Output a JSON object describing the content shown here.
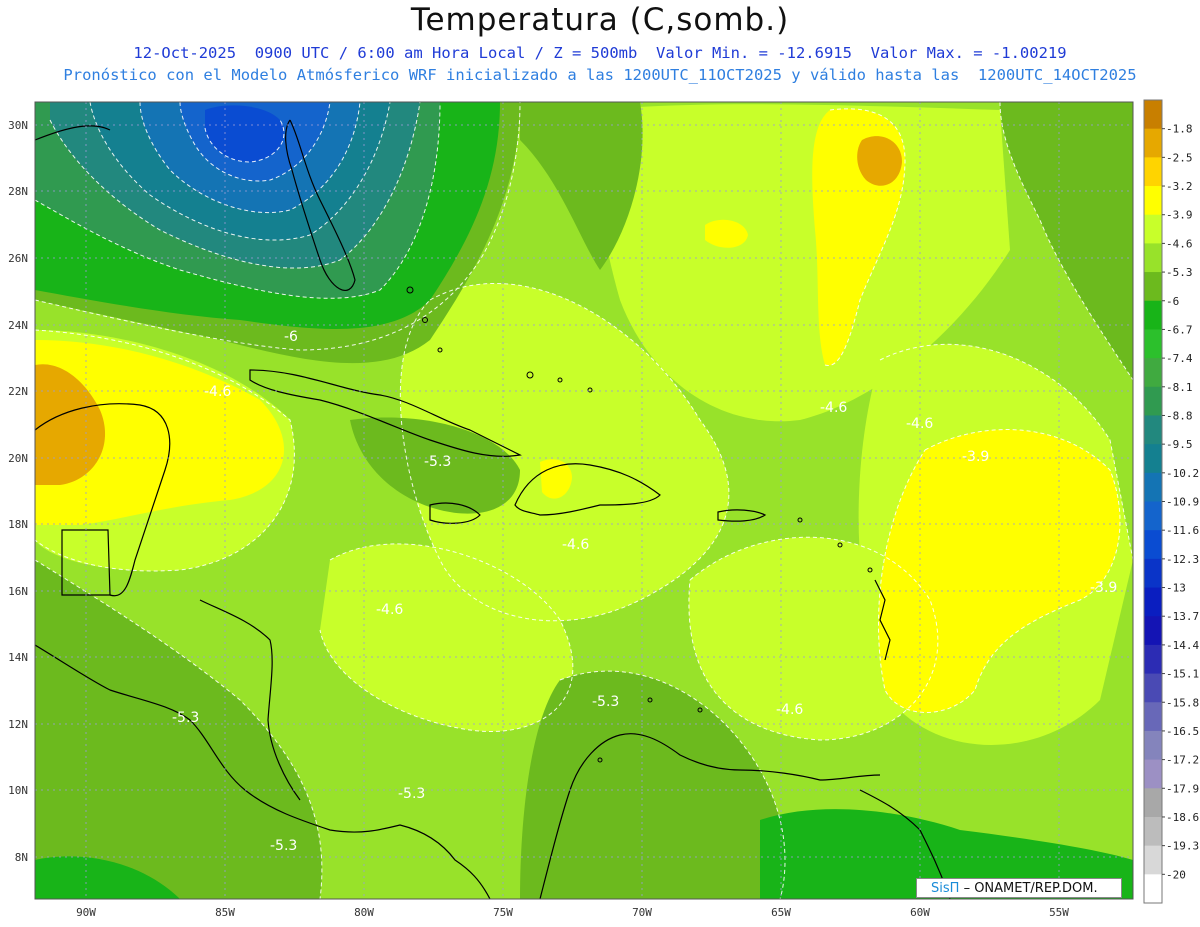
{
  "header": {
    "title": "Temperatura (C,somb.)",
    "line1": "12-Oct-2025  0900 UTC / 6:00 am Hora Local / Z = 500mb  Valor Min. = -12.6915  Valor Max. = -1.00219",
    "line2": "Pronóstico con el Modelo Atmósferico WRF inicializado a las 1200UTC_11OCT2025 y válido hasta las  1200UTC_14OCT2025"
  },
  "map": {
    "lon_ticks": [
      "90W",
      "85W",
      "80W",
      "75W",
      "70W",
      "65W",
      "60W",
      "55W"
    ],
    "lat_ticks": [
      "30N",
      "28N",
      "26N",
      "24N",
      "22N",
      "20N",
      "18N",
      "16N",
      "14N",
      "12N",
      "10N",
      "8N"
    ],
    "contour_labels": [
      "-6",
      "-4.6",
      "-4.6",
      "-4.6",
      "-3.9",
      "-5.3",
      "-4.6",
      "-4.6",
      "-3.9",
      "-5.3",
      "-4.6",
      "-5.3",
      "-5.3",
      "-5.3"
    ]
  },
  "legend": {
    "levels": [
      "-1.8",
      "-2.5",
      "-3.2",
      "-3.9",
      "-4.6",
      "-5.3",
      "-6",
      "-6.7",
      "-7.4",
      "-8.1",
      "-8.8",
      "-9.5",
      "-10.2",
      "-10.9",
      "-11.6",
      "-12.3",
      "-13",
      "-13.7",
      "-14.4",
      "-15.1",
      "-15.8",
      "-16.5",
      "-17.2",
      "-17.9",
      "-18.6",
      "-19.3",
      "-20"
    ],
    "colors": [
      "#c87f00",
      "#e6a800",
      "#ffd400",
      "#ffff00",
      "#c8ff2a",
      "#98e22a",
      "#6cba1e",
      "#18b418",
      "#2cc02c",
      "#40aa40",
      "#309a50",
      "#22887e",
      "#148090",
      "#1474b4",
      "#1464cc",
      "#0a4cd2",
      "#0a34c8",
      "#0a1ec0",
      "#1414b4",
      "#2c2cb4",
      "#4a4ab4",
      "#6868b8",
      "#8484bc",
      "#9c90c4",
      "#a8a8a8",
      "#bcbcbc",
      "#d8d8d8",
      "#ffffff"
    ]
  },
  "credit": {
    "brand": "SisΠ",
    "org": "– ONAMET/REP.DOM."
  }
}
